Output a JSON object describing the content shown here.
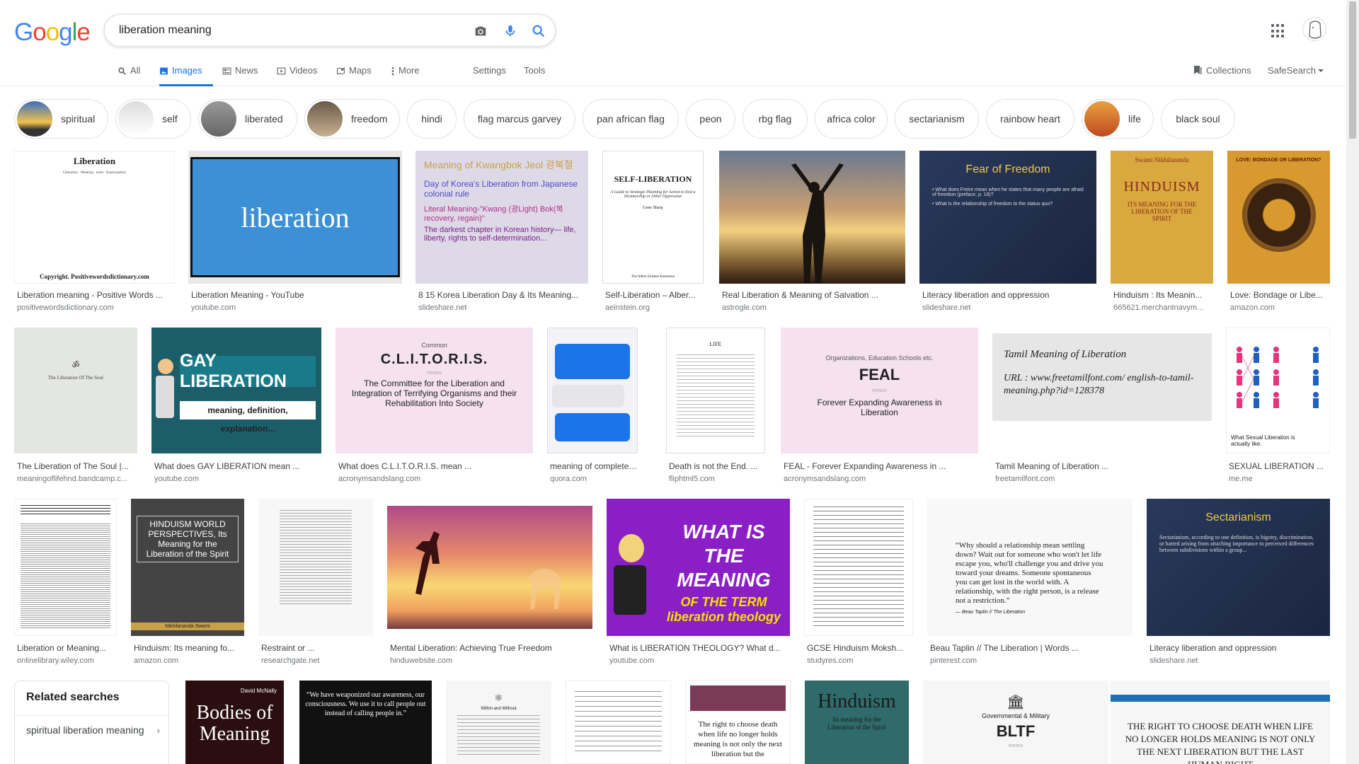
{
  "logo": {
    "letters": [
      "G",
      "o",
      "o",
      "g",
      "l",
      "e"
    ],
    "colors": [
      "#4285f4",
      "#ea4335",
      "#fbbc05",
      "#4285f4",
      "#34a853",
      "#ea4335"
    ]
  },
  "search": {
    "query": "liberation meaning",
    "icons": [
      "camera-icon",
      "mic-icon",
      "search-icon"
    ]
  },
  "tabs": [
    {
      "label": "All",
      "icon": "search-icon"
    },
    {
      "label": "Images",
      "icon": "image-icon",
      "active": true
    },
    {
      "label": "News",
      "icon": "news-icon"
    },
    {
      "label": "Videos",
      "icon": "video-icon"
    },
    {
      "label": "Maps",
      "icon": "map-icon"
    },
    {
      "label": "More",
      "icon": "more-vert-icon"
    }
  ],
  "tools": {
    "settings": "Settings",
    "tools": "Tools",
    "collections": "Collections",
    "safesearch": "SafeSearch"
  },
  "chips": [
    {
      "label": "spiritual",
      "thumb": true
    },
    {
      "label": "self",
      "thumb": true
    },
    {
      "label": "liberated",
      "thumb": true
    },
    {
      "label": "freedom",
      "thumb": true
    },
    {
      "label": "hindi"
    },
    {
      "label": "flag marcus garvey"
    },
    {
      "label": "pan african flag"
    },
    {
      "label": "peon"
    },
    {
      "label": "rbg flag"
    },
    {
      "label": "africa color"
    },
    {
      "label": "sectarianism"
    },
    {
      "label": "rainbow heart"
    },
    {
      "label": "life",
      "thumb": true
    },
    {
      "label": "black soul"
    }
  ],
  "results": {
    "row1": [
      {
        "caption": "Liberation meaning - Positive Words ...",
        "source": "positivewordsdictionary.com",
        "img_text": "Liberation",
        "img_sub": "Copyright.  Positivewordsdictionary.com"
      },
      {
        "caption": "Liberation Meaning - YouTube",
        "source": "youtube.com",
        "img_text": "liberation"
      },
      {
        "caption": "8 15 Korea Liberation Day & Its Meaning...",
        "source": "slideshare.net",
        "img_text": "Meaning of Kwangbok Jeol 광복절",
        "img_sub": "Day of Korea's Liberation from Japanese colonial rule"
      },
      {
        "caption": "Self-Liberation – Alber...",
        "source": "aeinstein.org",
        "img_text": "SELF-LIBERATION",
        "img_sub": "Gene Sharp"
      },
      {
        "caption": "Real Liberation & Meaning of Salvation ...",
        "source": "astrogle.com"
      },
      {
        "caption": "Literacy liberation and oppression",
        "source": "slideshare.net",
        "img_text": "Fear of Freedom"
      },
      {
        "caption": "Hinduism : Its Meanin...",
        "source": "665621.merchantnavym...",
        "img_text": "HINDUISM",
        "img_sub": "ITS MEANING FOR THE LIBERATION OF THE SPIRIT"
      },
      {
        "caption": "Love: Bondage or Libe...",
        "source": "amazon.com",
        "img_text": "LOVE: BONDAGE OR LIBERATION?"
      }
    ],
    "row2": [
      {
        "caption": "The Liberation of The Soul |...",
        "source": "meaningoflifehnd.bandcamp.c...",
        "img_text": "The Liberation Of The Soul"
      },
      {
        "caption": "What does GAY LIBERATION mean ...",
        "source": "youtube.com",
        "img_text": "GAY LIBERATION",
        "img_sub": "meaning, definition, explanation..."
      },
      {
        "caption": "What does C.L.I.T.O.R.I.S. mean ...",
        "source": "acronymsandslang.com",
        "img_text": "C.L.I.T.O.R.I.S.",
        "img_sub": "The Committee for the Liberation and Integration of Terrifying Organisms and their Rehabilitation Into Society"
      },
      {
        "caption": "meaning of complete li...",
        "source": "quora.com"
      },
      {
        "caption": "Death is not the End. ...",
        "source": "fliphtml5.com",
        "img_text": "LIFE"
      },
      {
        "caption": "FEAL - Forever Expanding Awareness in ...",
        "source": "acronymsandslang.com",
        "img_text": "FEAL",
        "img_sub": "Forever Expanding Awareness in Liberation"
      },
      {
        "caption": "Tamil Meaning of Liberation ...",
        "source": "freetamilfont.com",
        "img_text": "Tamil Meaning of Liberation",
        "img_sub": "URL : www.freetamilfont.com/ english-to-tamil-meaning.php?id=128378"
      },
      {
        "caption": "SEXUAL LIBERATION ...",
        "source": "me.me",
        "img_text": "What Sexual Liberation is actually like."
      }
    ],
    "row3": [
      {
        "caption": "Liberation or Meaning...",
        "source": "onlinelibrary.wiley.com"
      },
      {
        "caption": "Hinduism: Its meaning fo...",
        "source": "amazon.com",
        "img_text": "HINDUISM WORLD PERSPECTIVES, Its Meaning for the Liberation of the Spirit",
        "img_sub": "Nikhilananda Swami"
      },
      {
        "caption": "Restraint or ...",
        "source": "researchgate.net"
      },
      {
        "caption": "Mental Liberation: Achieving True Freedom",
        "source": "hinduwebsite.com"
      },
      {
        "caption": "What is LIBERATION THEOLOGY? What d...",
        "source": "youtube.com",
        "img_text": "WHAT IS THE MEANING",
        "img_sub": "OF THE TERM liberation theology"
      },
      {
        "caption": "GCSE Hinduism Moksh...",
        "source": "studyres.com"
      },
      {
        "caption": "Beau Taplin // The Liberation | Words ...",
        "source": "pinterest.com",
        "img_text": "“Why should a relationship mean settling down? Wait out for someone who won't let life escape you, who'll challenge you and drive you toward your dreams. Someone spontaneous you can get lost in the world with. A relationship, with the right person, is a release not a restriction.”"
      },
      {
        "caption": "Literacy liberation and oppression",
        "source": "slideshare.net",
        "img_text": "Sectarianism"
      }
    ],
    "row4": [
      {
        "img_text": "Bodies of Meaning",
        "img_sub": "David McNally"
      },
      {
        "img_text": "“We have weaponized our awareness, our consciousness. We use it to call people out instead of calling people in.”"
      },
      {
        "img_text": "Within and Without"
      },
      {
        "img_text": ""
      },
      {
        "img_text": "The right to choose death when life no longer holds meaning is not only the next liberation but the"
      },
      {
        "img_text": "Hinduism",
        "img_sub": "Its meaning for the Liberation of the Spirit"
      },
      {
        "img_text": "BLTF",
        "img_sub": "Governmental & Military"
      },
      {
        "img_text": "THE RIGHT TO CHOOSE DEATH WHEN LIFE NO LONGER HOLDS MEANING IS NOT ONLY THE NEXT LIBERATION BUT THE LAST HUMAN RIGHT"
      }
    ]
  },
  "related": {
    "heading": "Related searches",
    "items": [
      "spiritual liberation meaning"
    ]
  }
}
